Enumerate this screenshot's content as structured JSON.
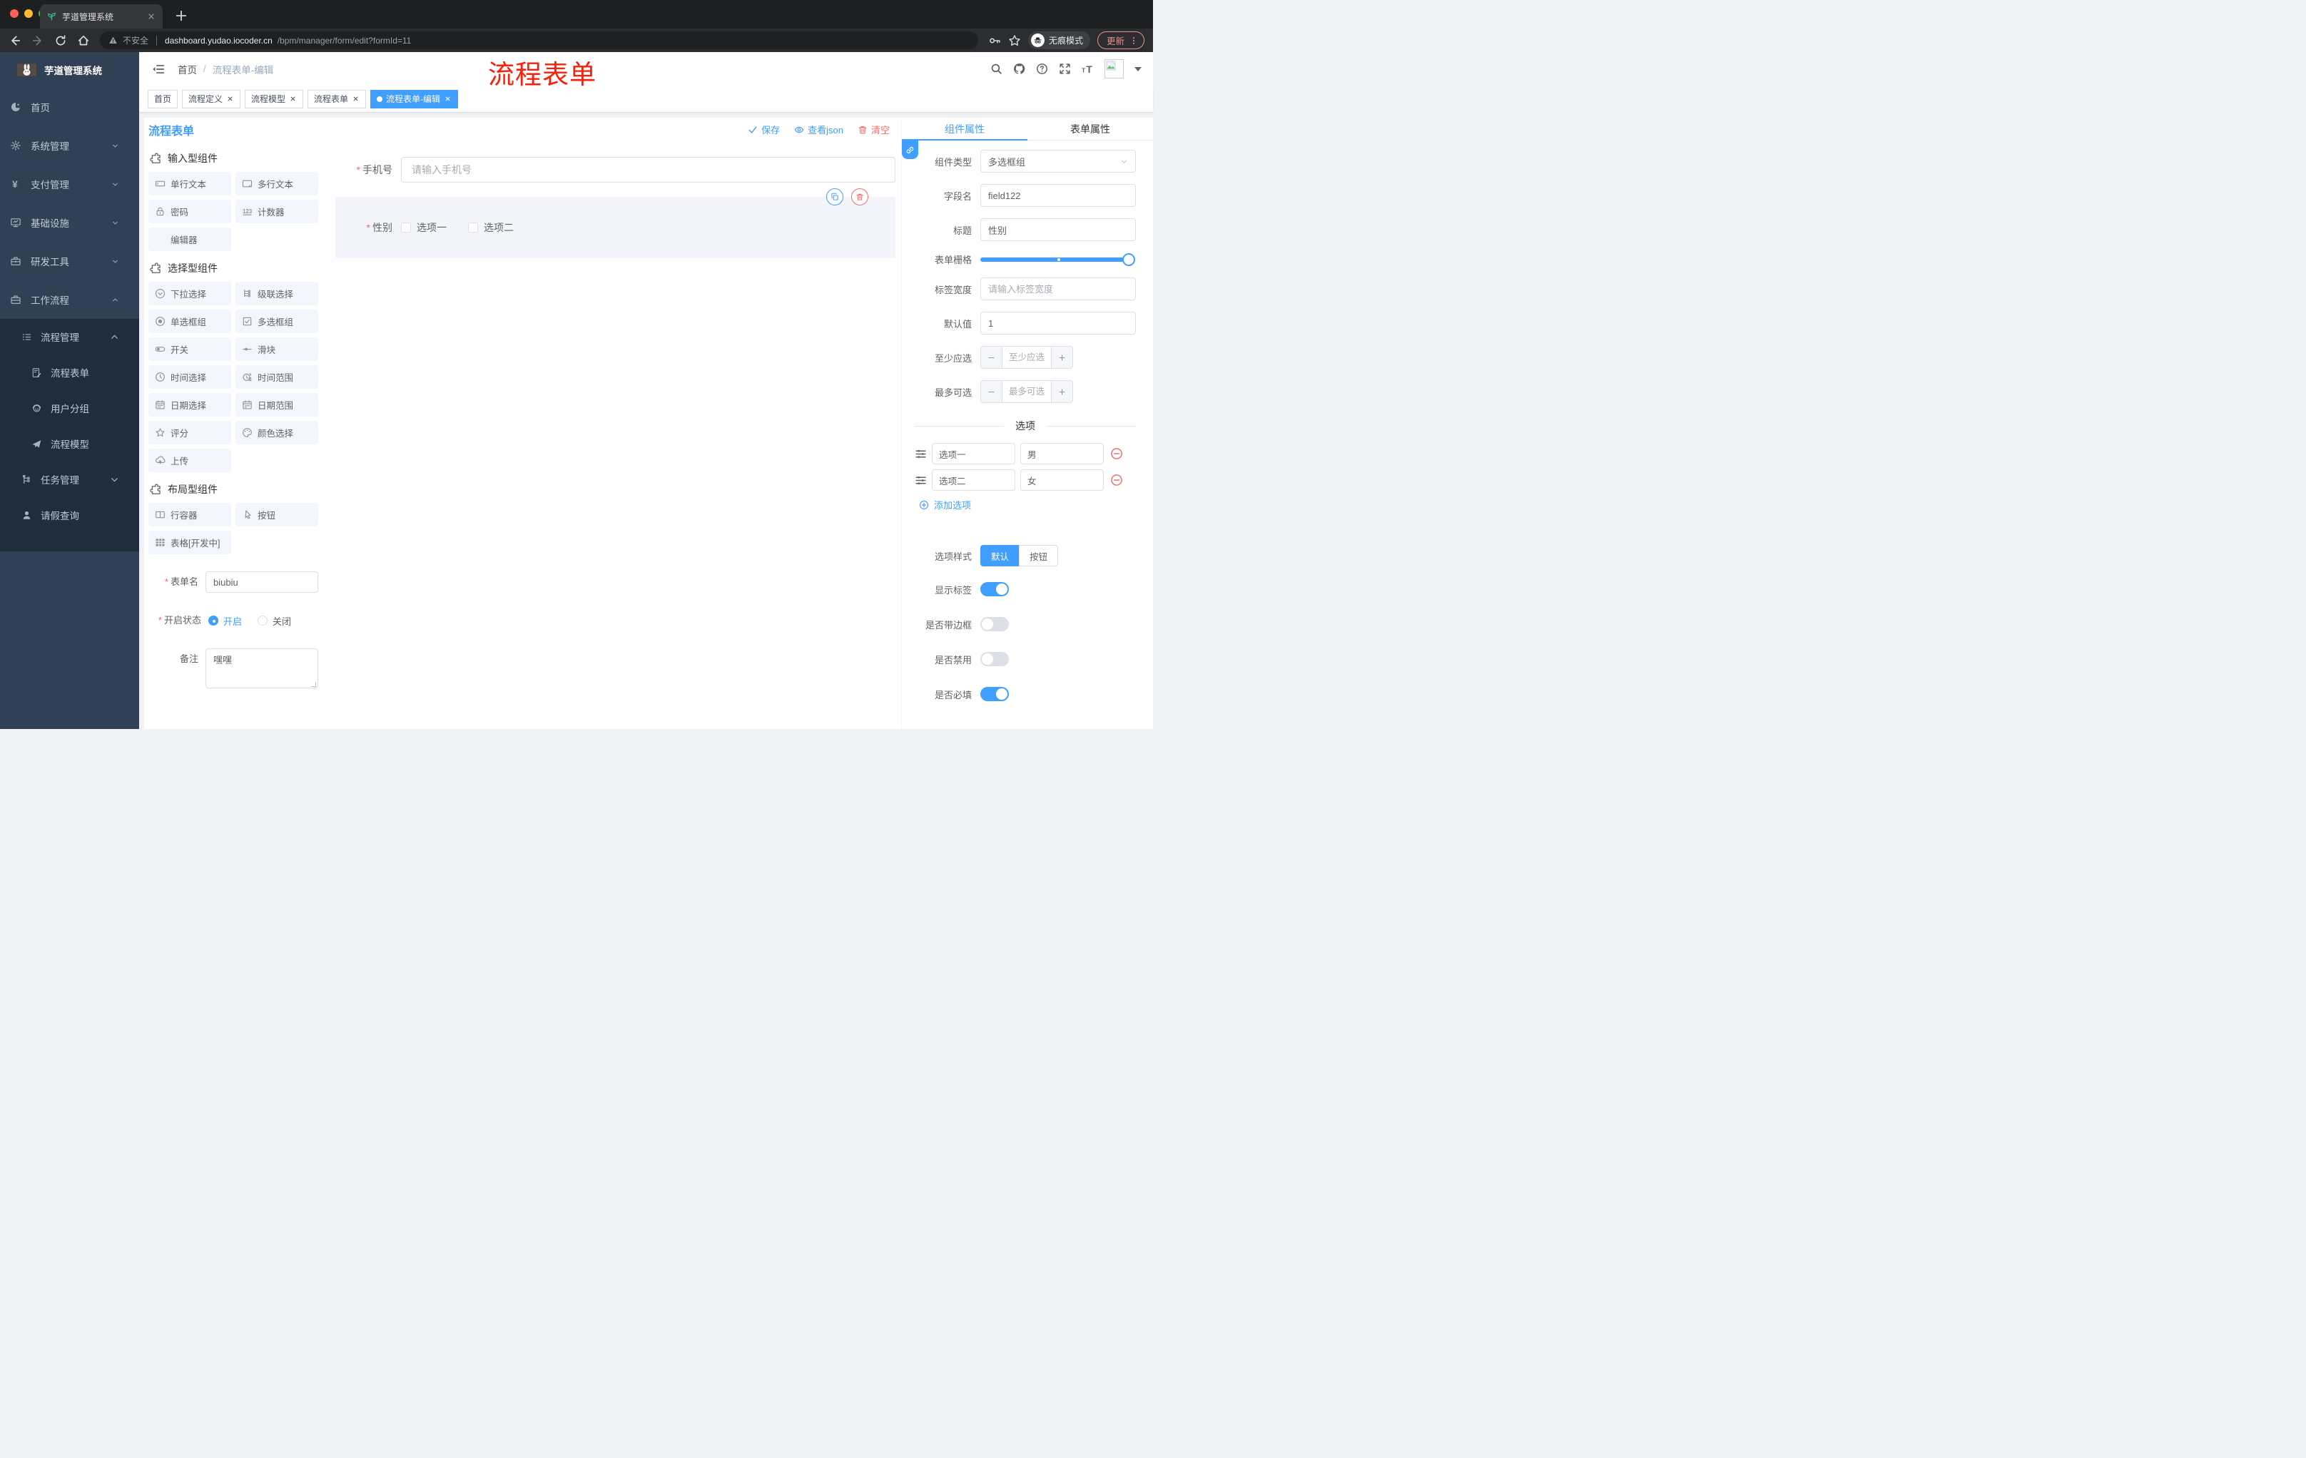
{
  "ui": {
    "required": "*",
    "breadcrumb_sep": "/"
  },
  "browser": {
    "tab_title": "芋道管理系统",
    "security": "不安全",
    "host": "dashboard.yudao.iocoder.cn",
    "path": "/bpm/manager/form/edit?formId=11",
    "incognito": "无痕模式",
    "update": "更新"
  },
  "sidebar": {
    "title": "芋道管理系统",
    "items": [
      {
        "label": "首页",
        "icon": "dashboard-icon",
        "arrow": ""
      },
      {
        "label": "系统管理",
        "icon": "gear-icon",
        "arrow": "down"
      },
      {
        "label": "支付管理",
        "icon": "yen-icon",
        "arrow": "down"
      },
      {
        "label": "基础设施",
        "icon": "monitor-icon",
        "arrow": "down"
      },
      {
        "label": "研发工具",
        "icon": "toolbox-icon",
        "arrow": "down"
      },
      {
        "label": "工作流程",
        "icon": "briefcase-icon",
        "arrow": "up"
      }
    ],
    "submenu": [
      {
        "label": "流程管理",
        "icon": "list-icon",
        "arrow": "up",
        "level": 1
      },
      {
        "label": "流程表单",
        "icon": "form-icon",
        "arrow": "",
        "level": 2
      },
      {
        "label": "用户分组",
        "icon": "group-icon",
        "arrow": "",
        "level": 2
      },
      {
        "label": "流程模型",
        "icon": "send-icon",
        "arrow": "",
        "level": 2
      },
      {
        "label": "任务管理",
        "icon": "tree-icon",
        "arrow": "down",
        "level": 1
      },
      {
        "label": "请假查询",
        "icon": "user-icon",
        "arrow": "",
        "level": 1
      }
    ]
  },
  "header": {
    "breadcrumb_home": "首页",
    "breadcrumb_current": "流程表单-编辑",
    "overlay": "流程表单"
  },
  "tags": [
    {
      "label": "首页",
      "closable": false,
      "active": false
    },
    {
      "label": "流程定义",
      "closable": true,
      "active": false
    },
    {
      "label": "流程模型",
      "closable": true,
      "active": false
    },
    {
      "label": "流程表单",
      "closable": true,
      "active": false
    },
    {
      "label": "流程表单-编辑",
      "closable": true,
      "active": true
    }
  ],
  "designer": {
    "title": "流程表单",
    "save": "保存",
    "view_json": "查看json",
    "clear": "清空"
  },
  "library": {
    "groups": [
      {
        "title": "输入型组件",
        "items": [
          {
            "label": "单行文本",
            "icon": "input-icon"
          },
          {
            "label": "多行文本",
            "icon": "textarea-icon"
          },
          {
            "label": "密码",
            "icon": "lock-icon"
          },
          {
            "label": "计数器",
            "icon": "counter-icon"
          },
          {
            "label": "编辑器",
            "icon": ""
          }
        ]
      },
      {
        "title": "选择型组件",
        "items": [
          {
            "label": "下拉选择",
            "icon": "select-icon"
          },
          {
            "label": "级联选择",
            "icon": "cascader-icon"
          },
          {
            "label": "单选框组",
            "icon": "radio-icon"
          },
          {
            "label": "多选框组",
            "icon": "checkbox-icon"
          },
          {
            "label": "开关",
            "icon": "switch-icon"
          },
          {
            "label": "滑块",
            "icon": "slider-icon"
          },
          {
            "label": "时间选择",
            "icon": "time-icon"
          },
          {
            "label": "时间范围",
            "icon": "time-range-icon"
          },
          {
            "label": "日期选择",
            "icon": "date-icon"
          },
          {
            "label": "日期范围",
            "icon": "date-range-icon"
          },
          {
            "label": "评分",
            "icon": "star-icon"
          },
          {
            "label": "颜色选择",
            "icon": "palette-icon"
          },
          {
            "label": "上传",
            "icon": "upload-icon"
          }
        ]
      },
      {
        "title": "布局型组件",
        "items": [
          {
            "label": "行容器",
            "icon": "row-icon"
          },
          {
            "label": "按钮",
            "icon": "button-icon"
          },
          {
            "label": "表格[开发中]",
            "icon": "table-icon"
          }
        ]
      }
    ]
  },
  "meta_form": {
    "name_label": "表单名",
    "name_value": "biubiu",
    "status_label": "开启状态",
    "status_on": "开启",
    "status_off": "关闭",
    "remark_label": "备注",
    "remark_value": "嘿嘿"
  },
  "canvas": {
    "phone_label": "手机号",
    "phone_placeholder": "请输入手机号",
    "gender_label": "性别",
    "gender_options": [
      "选项一",
      "选项二"
    ]
  },
  "props": {
    "tab_component": "组件属性",
    "tab_form": "表单属性",
    "type_label": "组件类型",
    "type_value": "多选框组",
    "field_label": "字段名",
    "field_value": "field122",
    "title_label": "标题",
    "title_value": "性别",
    "grid_label": "表单栅格",
    "label_width_label": "标签宽度",
    "label_width_placeholder": "请输入标签宽度",
    "default_label": "默认值",
    "default_value": "1",
    "min_label": "至少应选",
    "min_placeholder": "至少应选",
    "max_label": "最多可选",
    "max_placeholder": "最多可选",
    "options_title": "选项",
    "options": [
      {
        "label": "选项一",
        "value": "男"
      },
      {
        "label": "选项二",
        "value": "女"
      }
    ],
    "add_option": "添加选项",
    "style_label": "选项样式",
    "style_default": "默认",
    "style_button": "按钮",
    "toggles": [
      {
        "label": "显示标签",
        "on": true
      },
      {
        "label": "是否带边框",
        "on": false
      },
      {
        "label": "是否禁用",
        "on": false
      },
      {
        "label": "是否必填",
        "on": true
      }
    ]
  }
}
